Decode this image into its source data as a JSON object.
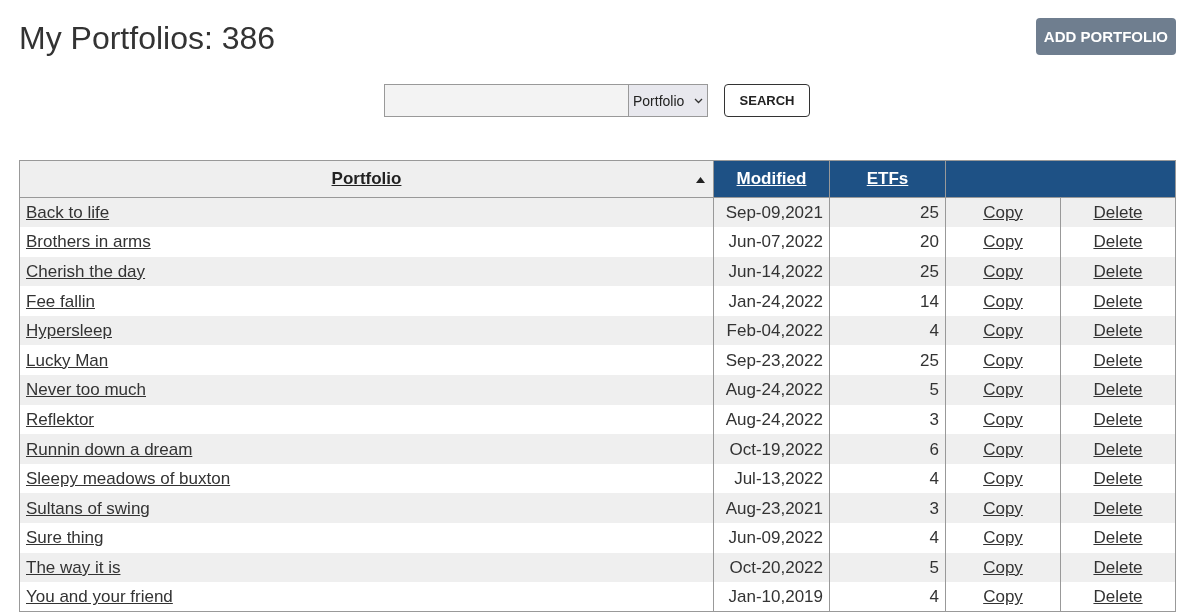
{
  "page": {
    "title": "My Portfolios: 386",
    "add_button": "ADD PORTFOLIO"
  },
  "search": {
    "scope": "Portfolio",
    "button": "SEARCH"
  },
  "table": {
    "columns": [
      {
        "label": "Portfolio",
        "sorted": true
      },
      {
        "label": "Modified",
        "sorted": false
      },
      {
        "label": "ETFs",
        "sorted": false
      }
    ],
    "rows": [
      {
        "name": "Back to life",
        "modified": "Sep-09,2021",
        "etfs": "25",
        "copy": "Copy",
        "delete": "Delete"
      },
      {
        "name": "Brothers in arms",
        "modified": "Jun-07,2022",
        "etfs": "20",
        "copy": "Copy",
        "delete": "Delete"
      },
      {
        "name": "Cherish the day",
        "modified": "Jun-14,2022",
        "etfs": "25",
        "copy": "Copy",
        "delete": "Delete"
      },
      {
        "name": "Fee fallin",
        "modified": "Jan-24,2022",
        "etfs": "14",
        "copy": "Copy",
        "delete": "Delete"
      },
      {
        "name": "Hypersleep",
        "modified": "Feb-04,2022",
        "etfs": "4",
        "copy": "Copy",
        "delete": "Delete"
      },
      {
        "name": "Lucky Man",
        "modified": "Sep-23,2022",
        "etfs": "25",
        "copy": "Copy",
        "delete": "Delete"
      },
      {
        "name": "Never too much",
        "modified": "Aug-24,2022",
        "etfs": "5",
        "copy": "Copy",
        "delete": "Delete"
      },
      {
        "name": "Reflektor",
        "modified": "Aug-24,2022",
        "etfs": "3",
        "copy": "Copy",
        "delete": "Delete"
      },
      {
        "name": "Runnin down a dream",
        "modified": "Oct-19,2022",
        "etfs": "6",
        "copy": "Copy",
        "delete": "Delete"
      },
      {
        "name": "Sleepy meadows of buxton",
        "modified": "Jul-13,2022",
        "etfs": "4",
        "copy": "Copy",
        "delete": "Delete"
      },
      {
        "name": "Sultans of swing",
        "modified": "Aug-23,2021",
        "etfs": "3",
        "copy": "Copy",
        "delete": "Delete"
      },
      {
        "name": "Sure thing",
        "modified": "Jun-09,2022",
        "etfs": "4",
        "copy": "Copy",
        "delete": "Delete"
      },
      {
        "name": "The way it is",
        "modified": "Oct-20,2022",
        "etfs": "5",
        "copy": "Copy",
        "delete": "Delete"
      },
      {
        "name": "You and your friend",
        "modified": "Jan-10,2019",
        "etfs": "4",
        "copy": "Copy",
        "delete": "Delete"
      }
    ]
  }
}
